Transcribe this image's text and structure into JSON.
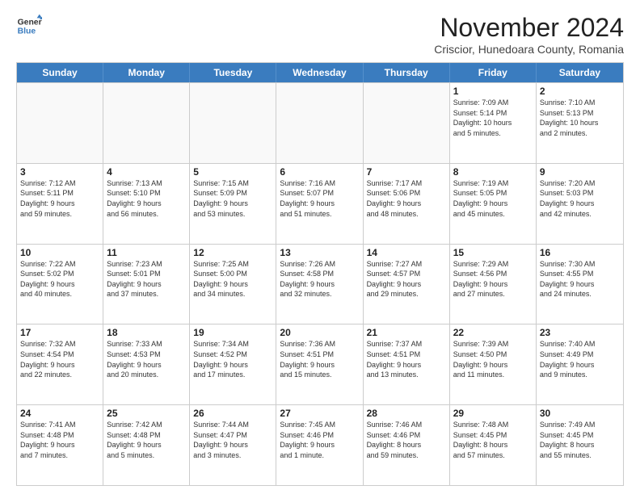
{
  "header": {
    "logo": {
      "general": "General",
      "blue": "Blue"
    },
    "title": "November 2024",
    "subtitle": "Criscior, Hunedoara County, Romania"
  },
  "weekdays": [
    "Sunday",
    "Monday",
    "Tuesday",
    "Wednesday",
    "Thursday",
    "Friday",
    "Saturday"
  ],
  "weeks": [
    [
      {
        "day": "",
        "info": ""
      },
      {
        "day": "",
        "info": ""
      },
      {
        "day": "",
        "info": ""
      },
      {
        "day": "",
        "info": ""
      },
      {
        "day": "",
        "info": ""
      },
      {
        "day": "1",
        "info": "Sunrise: 7:09 AM\nSunset: 5:14 PM\nDaylight: 10 hours\nand 5 minutes."
      },
      {
        "day": "2",
        "info": "Sunrise: 7:10 AM\nSunset: 5:13 PM\nDaylight: 10 hours\nand 2 minutes."
      }
    ],
    [
      {
        "day": "3",
        "info": "Sunrise: 7:12 AM\nSunset: 5:11 PM\nDaylight: 9 hours\nand 59 minutes."
      },
      {
        "day": "4",
        "info": "Sunrise: 7:13 AM\nSunset: 5:10 PM\nDaylight: 9 hours\nand 56 minutes."
      },
      {
        "day": "5",
        "info": "Sunrise: 7:15 AM\nSunset: 5:09 PM\nDaylight: 9 hours\nand 53 minutes."
      },
      {
        "day": "6",
        "info": "Sunrise: 7:16 AM\nSunset: 5:07 PM\nDaylight: 9 hours\nand 51 minutes."
      },
      {
        "day": "7",
        "info": "Sunrise: 7:17 AM\nSunset: 5:06 PM\nDaylight: 9 hours\nand 48 minutes."
      },
      {
        "day": "8",
        "info": "Sunrise: 7:19 AM\nSunset: 5:05 PM\nDaylight: 9 hours\nand 45 minutes."
      },
      {
        "day": "9",
        "info": "Sunrise: 7:20 AM\nSunset: 5:03 PM\nDaylight: 9 hours\nand 42 minutes."
      }
    ],
    [
      {
        "day": "10",
        "info": "Sunrise: 7:22 AM\nSunset: 5:02 PM\nDaylight: 9 hours\nand 40 minutes."
      },
      {
        "day": "11",
        "info": "Sunrise: 7:23 AM\nSunset: 5:01 PM\nDaylight: 9 hours\nand 37 minutes."
      },
      {
        "day": "12",
        "info": "Sunrise: 7:25 AM\nSunset: 5:00 PM\nDaylight: 9 hours\nand 34 minutes."
      },
      {
        "day": "13",
        "info": "Sunrise: 7:26 AM\nSunset: 4:58 PM\nDaylight: 9 hours\nand 32 minutes."
      },
      {
        "day": "14",
        "info": "Sunrise: 7:27 AM\nSunset: 4:57 PM\nDaylight: 9 hours\nand 29 minutes."
      },
      {
        "day": "15",
        "info": "Sunrise: 7:29 AM\nSunset: 4:56 PM\nDaylight: 9 hours\nand 27 minutes."
      },
      {
        "day": "16",
        "info": "Sunrise: 7:30 AM\nSunset: 4:55 PM\nDaylight: 9 hours\nand 24 minutes."
      }
    ],
    [
      {
        "day": "17",
        "info": "Sunrise: 7:32 AM\nSunset: 4:54 PM\nDaylight: 9 hours\nand 22 minutes."
      },
      {
        "day": "18",
        "info": "Sunrise: 7:33 AM\nSunset: 4:53 PM\nDaylight: 9 hours\nand 20 minutes."
      },
      {
        "day": "19",
        "info": "Sunrise: 7:34 AM\nSunset: 4:52 PM\nDaylight: 9 hours\nand 17 minutes."
      },
      {
        "day": "20",
        "info": "Sunrise: 7:36 AM\nSunset: 4:51 PM\nDaylight: 9 hours\nand 15 minutes."
      },
      {
        "day": "21",
        "info": "Sunrise: 7:37 AM\nSunset: 4:51 PM\nDaylight: 9 hours\nand 13 minutes."
      },
      {
        "day": "22",
        "info": "Sunrise: 7:39 AM\nSunset: 4:50 PM\nDaylight: 9 hours\nand 11 minutes."
      },
      {
        "day": "23",
        "info": "Sunrise: 7:40 AM\nSunset: 4:49 PM\nDaylight: 9 hours\nand 9 minutes."
      }
    ],
    [
      {
        "day": "24",
        "info": "Sunrise: 7:41 AM\nSunset: 4:48 PM\nDaylight: 9 hours\nand 7 minutes."
      },
      {
        "day": "25",
        "info": "Sunrise: 7:42 AM\nSunset: 4:48 PM\nDaylight: 9 hours\nand 5 minutes."
      },
      {
        "day": "26",
        "info": "Sunrise: 7:44 AM\nSunset: 4:47 PM\nDaylight: 9 hours\nand 3 minutes."
      },
      {
        "day": "27",
        "info": "Sunrise: 7:45 AM\nSunset: 4:46 PM\nDaylight: 9 hours\nand 1 minute."
      },
      {
        "day": "28",
        "info": "Sunrise: 7:46 AM\nSunset: 4:46 PM\nDaylight: 8 hours\nand 59 minutes."
      },
      {
        "day": "29",
        "info": "Sunrise: 7:48 AM\nSunset: 4:45 PM\nDaylight: 8 hours\nand 57 minutes."
      },
      {
        "day": "30",
        "info": "Sunrise: 7:49 AM\nSunset: 4:45 PM\nDaylight: 8 hours\nand 55 minutes."
      }
    ]
  ]
}
